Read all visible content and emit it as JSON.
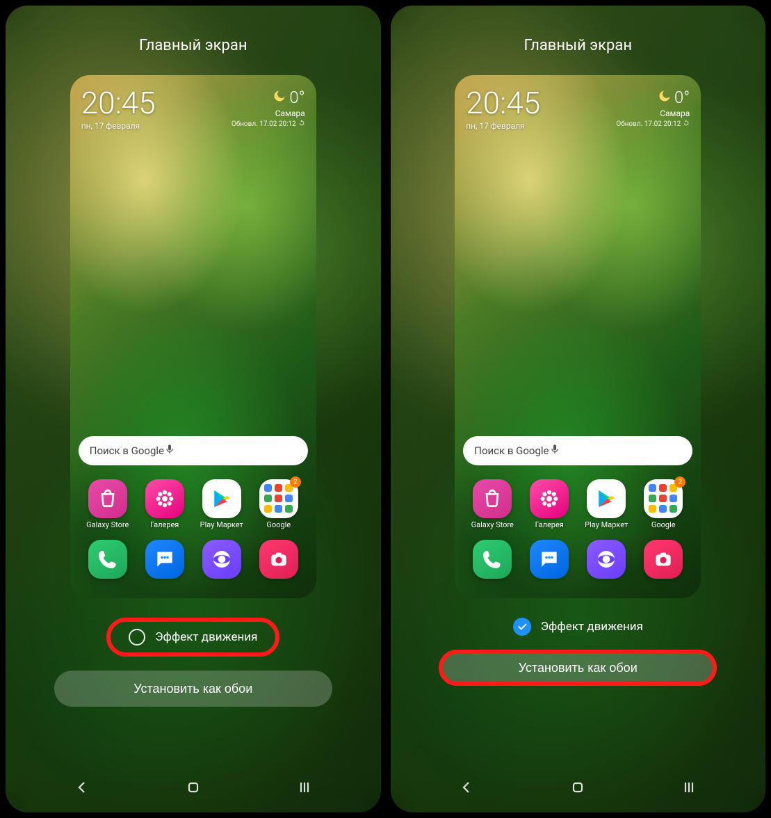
{
  "header": {
    "title": "Главный экран"
  },
  "clock": {
    "time": "20:45",
    "date": "пн, 17 февраля"
  },
  "weather": {
    "temp": "0°",
    "city": "Самара",
    "updated": "Обновл. 17.02 20:12"
  },
  "search": {
    "placeholder": "Поиск в Google"
  },
  "apps": {
    "row1": [
      {
        "name": "galaxy-store",
        "label": "Galaxy Store"
      },
      {
        "name": "gallery",
        "label": "Галерея"
      },
      {
        "name": "play-market",
        "label": "Play Маркет"
      },
      {
        "name": "google-folder",
        "label": "Google",
        "badge": "2"
      }
    ],
    "dock": [
      {
        "name": "phone"
      },
      {
        "name": "messages"
      },
      {
        "name": "browser"
      },
      {
        "name": "camera"
      }
    ]
  },
  "motion": {
    "label": "Эффект движения"
  },
  "setButton": {
    "label": "Установить как обои"
  },
  "panes": [
    {
      "motionChecked": false,
      "highlight": "motion"
    },
    {
      "motionChecked": true,
      "highlight": "set"
    }
  ]
}
